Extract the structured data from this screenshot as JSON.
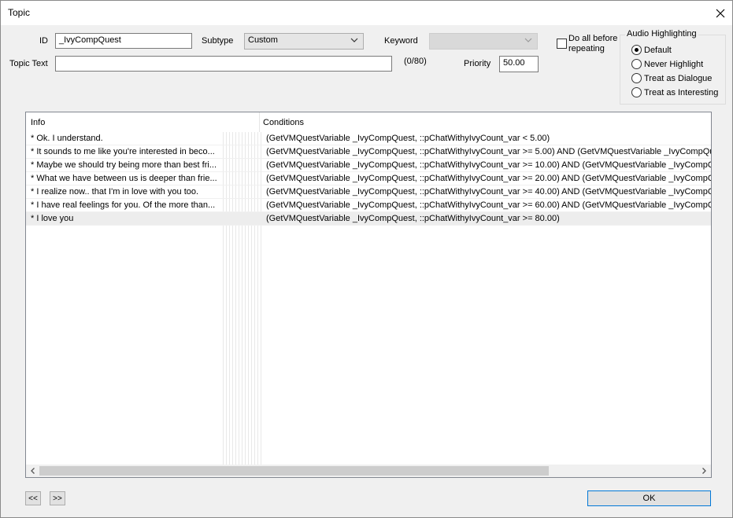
{
  "window": {
    "title": "Topic"
  },
  "form": {
    "id_label": "ID",
    "id_value": "_IvyCompQuest",
    "subtype_label": "Subtype",
    "subtype_value": "Custom",
    "keyword_label": "Keyword",
    "keyword_value": "",
    "do_all_label_1": "Do all before",
    "do_all_label_2": "repeating",
    "do_all_checked": false,
    "topic_text_label": "Topic Text",
    "topic_text_value": "",
    "char_count": "(0/80)",
    "priority_label": "Priority",
    "priority_value": "50.00"
  },
  "audio": {
    "title": "Audio Highlighting",
    "options": [
      {
        "label": "Default",
        "checked": true
      },
      {
        "label": "Never Highlight",
        "checked": false
      },
      {
        "label": "Treat as Dialogue",
        "checked": false
      },
      {
        "label": "Treat as Interesting",
        "checked": false
      }
    ]
  },
  "list": {
    "columns": [
      "Info",
      "Conditions"
    ],
    "rows": [
      {
        "info": "* Ok. I understand.",
        "conditions": "(GetVMQuestVariable _IvyCompQuest, ::pChatWithyIvyCount_var < 5.00)"
      },
      {
        "info": "* It sounds to me like you're interested in beco...",
        "conditions": "(GetVMQuestVariable _IvyCompQuest, ::pChatWithyIvyCount_var >= 5.00) AND (GetVMQuestVariable _IvyCompQu"
      },
      {
        "info": "* Maybe we should try being more than best fri...",
        "conditions": "(GetVMQuestVariable _IvyCompQuest, ::pChatWithyIvyCount_var >= 10.00) AND (GetVMQuestVariable _IvyCompQ"
      },
      {
        "info": "* What we have between us is deeper than frie...",
        "conditions": "(GetVMQuestVariable _IvyCompQuest, ::pChatWithyIvyCount_var >= 20.00) AND (GetVMQuestVariable _IvyCompQ"
      },
      {
        "info": "* I realize now.. that I'm in love with you too.",
        "conditions": "(GetVMQuestVariable _IvyCompQuest, ::pChatWithyIvyCount_var >= 40.00) AND (GetVMQuestVariable _IvyCompQ"
      },
      {
        "info": "* I have real feelings for you. Of the more than...",
        "conditions": "(GetVMQuestVariable _IvyCompQuest, ::pChatWithyIvyCount_var >= 60.00) AND (GetVMQuestVariable _IvyCompQ"
      },
      {
        "info": "* I love you",
        "conditions": "(GetVMQuestVariable _IvyCompQuest, ::pChatWithyIvyCount_var >= 80.00)"
      }
    ],
    "selected_row": 6
  },
  "buttons": {
    "prev": "<<",
    "next": ">>",
    "ok": "OK"
  }
}
